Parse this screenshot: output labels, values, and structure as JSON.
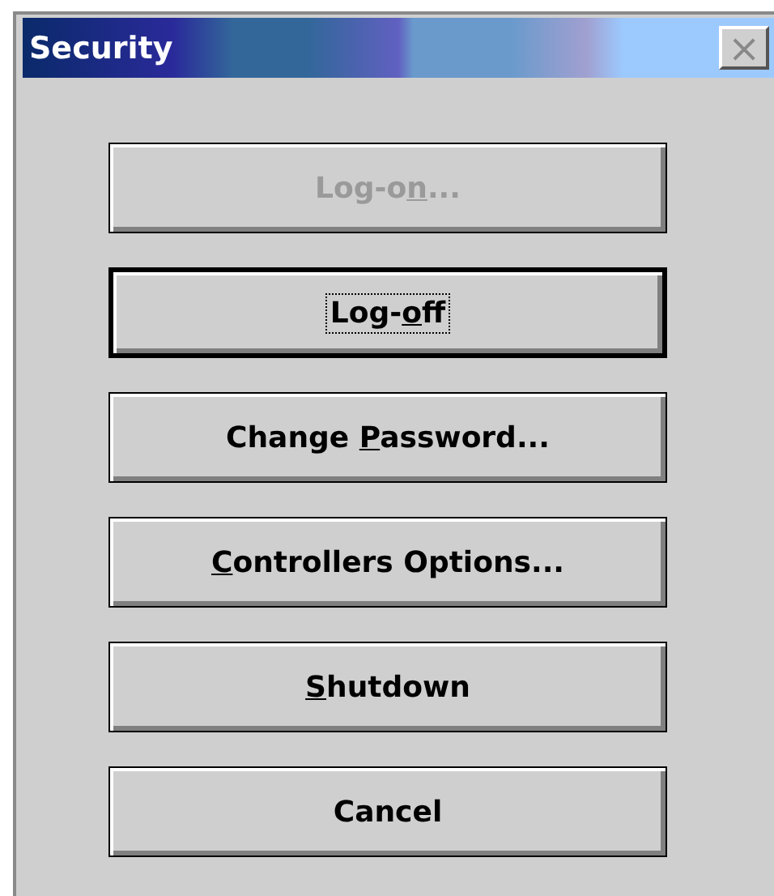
{
  "window": {
    "title": "Security",
    "close": "×"
  },
  "buttons": [
    {
      "pre": "Log-o",
      "key": "n",
      "post": "...",
      "disabled": true,
      "focused": false
    },
    {
      "pre": "Log-",
      "key": "o",
      "post": "ff",
      "disabled": false,
      "focused": true
    },
    {
      "pre": "Change ",
      "key": "P",
      "post": "assword...",
      "disabled": false,
      "focused": false
    },
    {
      "key": "C",
      "post": "ontrollers Options...",
      "disabled": false,
      "focused": false
    },
    {
      "key": "S",
      "post": "hutdown",
      "disabled": false,
      "focused": false
    },
    {
      "pre": "Cancel",
      "disabled": false,
      "focused": false
    }
  ]
}
